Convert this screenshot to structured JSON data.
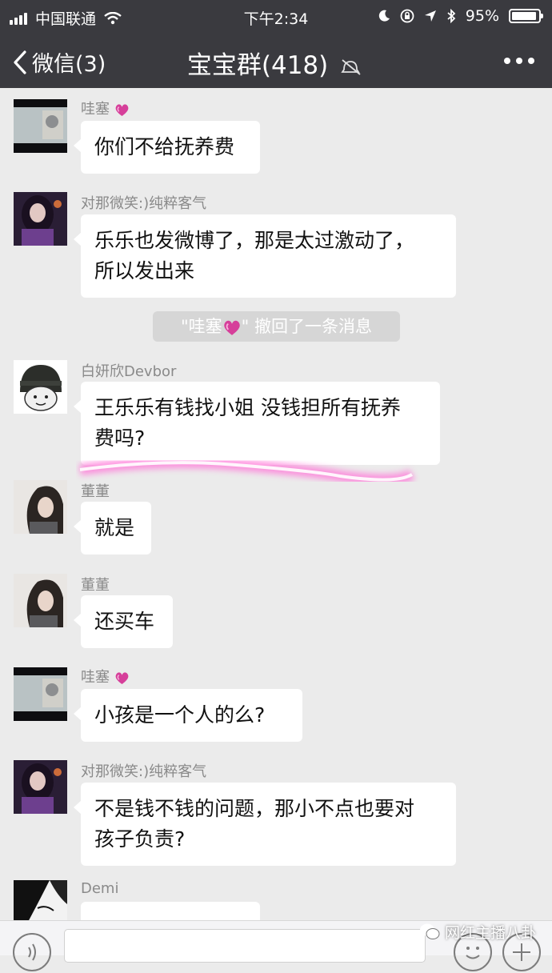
{
  "status_bar": {
    "carrier": "中国联通",
    "time": "下午2:34",
    "battery": "95%",
    "battery_level": 0.95
  },
  "nav": {
    "back_label": "微信(3)",
    "title": "宝宝群(418)"
  },
  "messages": [
    {
      "sender": "哇塞",
      "text": "你们不给抚养费"
    },
    {
      "sender": "对那微笑:)纯粹客气",
      "lines": [
        "乐乐也发微博了，那是太过激动了，",
        "所以发出来"
      ]
    },
    {
      "system": {
        "prefix": "\"哇塞",
        "suffix": "\" 撤回了一条消息"
      }
    },
    {
      "sender": "白妍欣Devbor",
      "lines": [
        "王乐乐有钱找小姐 没钱担所有抚养",
        "费吗?"
      ]
    },
    {
      "sender": "董董",
      "text": "就是"
    },
    {
      "sender": "董董",
      "text": "还买车"
    },
    {
      "sender": "哇塞",
      "text": "小孩是一个人的么?"
    },
    {
      "sender": "对那微笑:)纯粹客气",
      "lines": [
        "不是钱不钱的问题，那小不点也要对",
        "孩子负责?"
      ]
    },
    {
      "sender": "Demi",
      "text": ""
    }
  ],
  "watermark": "网红主播八卦",
  "colors": {
    "nav_bg": "#3a3a3f",
    "chat_bg": "#ebebeb",
    "bubble_bg": "#ffffff",
    "sender_name": "#8a8a8a",
    "heart": "#d63f9a",
    "highlight": "#ff7ad9"
  },
  "icons": [
    "signal-icon",
    "wifi-icon",
    "moon-icon",
    "orientation-lock-icon",
    "location-icon",
    "bluetooth-icon",
    "battery-icon",
    "back-chevron-icon",
    "mute-icon",
    "more-icon",
    "heart-emoji-icon",
    "voice-icon",
    "emoji-icon",
    "plus-icon"
  ]
}
